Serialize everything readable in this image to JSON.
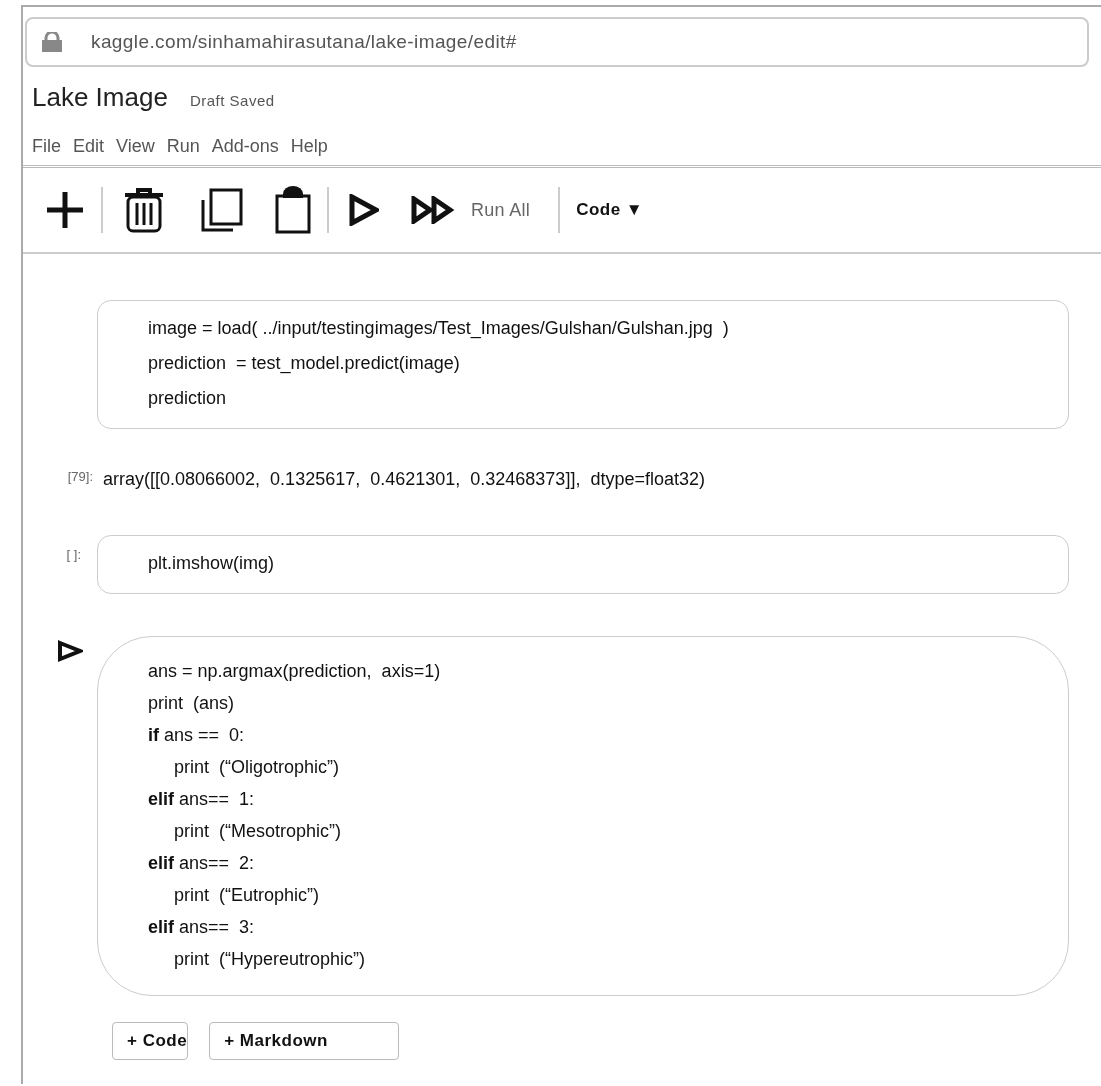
{
  "address_bar": {
    "url": "kaggle.com/sinhamahirasutana/lake-image/edit#"
  },
  "notebook": {
    "title": "Lake Image",
    "status": "Draft Saved"
  },
  "menu": [
    "File",
    "Edit",
    "View",
    "Run",
    "Add-ons",
    "Help"
  ],
  "toolbar": {
    "run_all": "Run All",
    "cell_type": "Code ▼"
  },
  "cells": [
    {
      "kind": "code",
      "selected": false,
      "lines": [
        {
          "text": "image = load( ../input/testingimages/Test_Images/Gulshan/Gulshan.jpg  )"
        },
        {
          "text": "prediction  = test_model.predict(image)"
        },
        {
          "text": "prediction"
        }
      ]
    },
    {
      "kind": "output",
      "prompt": "[79]:",
      "text": "array([[0.08066002,  0.1325617,  0.4621301,  0.32468373]],  dtype=float32)"
    },
    {
      "kind": "code",
      "selected": false,
      "prompt": "[ ]:",
      "lines": [
        {
          "text": "plt.imshow(img)"
        }
      ]
    },
    {
      "kind": "code",
      "selected": true,
      "lines": [
        {
          "text": "ans = np.argmax(prediction,  axis=1)"
        },
        {
          "text": "print  (ans)"
        },
        {
          "text": "**if** ans ==  0:",
          "children": [
            {
              "text": "print  (“Oligotrophic”)"
            }
          ]
        },
        {
          "text": "**elif** ans==  1:",
          "children": [
            {
              "text": "print  (“Mesotrophic”)"
            }
          ]
        },
        {
          "text": "**elif** ans==  2:",
          "children": [
            {
              "text": "print  (“Eutrophic”)"
            }
          ]
        },
        {
          "text": "**elif** ans==  3:",
          "children": [
            {
              "text": "print  (“Hypereutrophic”)"
            }
          ]
        }
      ]
    }
  ],
  "add_buttons": [
    "+ Code",
    "+ Markdown"
  ]
}
